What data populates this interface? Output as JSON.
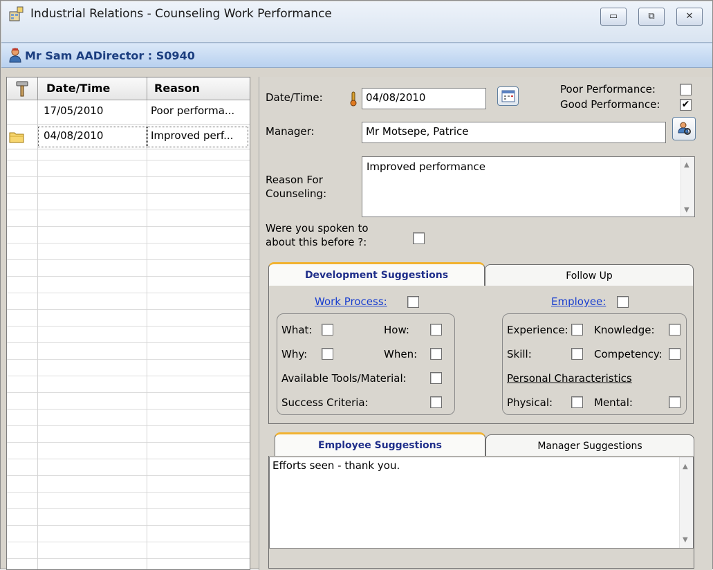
{
  "window": {
    "title": "Industrial Relations - Counseling Work Performance",
    "minimize": "▭",
    "restore": "⧉",
    "close": "✕"
  },
  "user": {
    "label": "Mr Sam AADirector  :  S0940"
  },
  "grid": {
    "columns": [
      "Date/Time",
      "Reason"
    ],
    "rows": [
      {
        "date": "17/05/2010",
        "reason": "Poor performa..."
      },
      {
        "date": "04/08/2010",
        "reason": "Improved perf..."
      }
    ]
  },
  "form": {
    "datetime_label": "Date/Time:",
    "datetime_value": "04/08/2010",
    "poor_performance_label": "Poor Performance:",
    "poor_performance_checked": "",
    "good_performance_label": "Good Performance:",
    "good_performance_checked": "✔",
    "manager_label": "Manager:",
    "manager_value": "Mr Motsepe, Patrice",
    "reason_label": "Reason For Counseling:",
    "reason_label_line1": "Reason For",
    "reason_label_line2": "Counseling:",
    "reason_value": "Improved performance",
    "spoken_label_line1": "Were you spoken to",
    "spoken_label_line2": "about this before ?:"
  },
  "tabs_top": {
    "active": "Development Suggestions",
    "inactive": "Follow Up"
  },
  "dev": {
    "work_process": "Work Process:",
    "employee": "Employee:",
    "what": "What:",
    "how": "How:",
    "why": "Why:",
    "when": "When:",
    "tools": "Available Tools/Material:",
    "success": "Success Criteria:",
    "experience": "Experience:",
    "knowledge": "Knowledge:",
    "skill": "Skill:",
    "competency": "Competency:",
    "personal": "Personal Characteristics",
    "physical": "Physical:",
    "mental": "Mental:"
  },
  "tabs_bottom": {
    "active": "Employee Suggestions",
    "inactive": "Manager Suggestions"
  },
  "suggestion_text": "Efforts seen - thank you.",
  "colors": {
    "title_accent": "#1c3f80",
    "tab_active_text": "#1f2e8a",
    "tab_active_bar": "#f1b230",
    "link": "#1a3fcf"
  }
}
